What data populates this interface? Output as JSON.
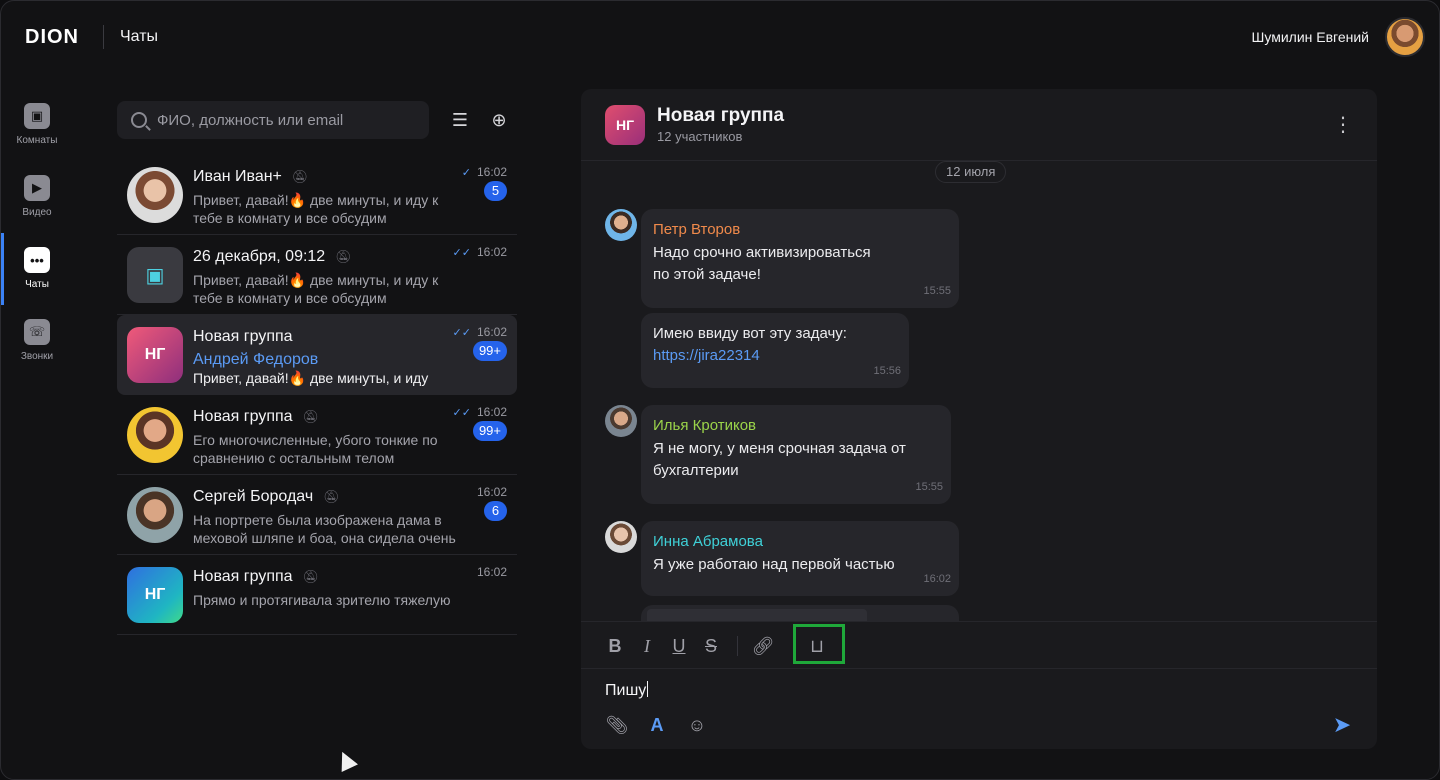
{
  "app": {
    "logo": "DION",
    "section_title": "Чаты",
    "user_name": "Шумилин Евгений"
  },
  "rail": [
    {
      "label": "Комнаты",
      "icon": "rooms-icon",
      "glyph": "▣"
    },
    {
      "label": "Видео",
      "icon": "video-icon",
      "glyph": "▶"
    },
    {
      "label": "Чаты",
      "icon": "chat-icon",
      "glyph": "•••",
      "active": true
    },
    {
      "label": "Звонки",
      "icon": "calls-icon",
      "glyph": "☏"
    }
  ],
  "search": {
    "placeholder": "ФИО, должность или email"
  },
  "chats": [
    {
      "name": "Иван Иван+",
      "preview": "Привет, давай!🔥 две минуты, и иду к тебе в комнату и все обсудим",
      "time": "16:02",
      "check": "✓",
      "badge": "5",
      "muted": true
    },
    {
      "name": "26 декабря, 09:12",
      "preview": "Привет, давай!🔥 две минуты, и иду к тебе в комнату и все обсудим",
      "time": "16:02",
      "check": "✓✓",
      "badge": "",
      "muted": true
    },
    {
      "name": "Новая группа",
      "author": "Андрей Федоров",
      "preview": "Привет, давай!🔥 две минуты, и иду",
      "time": "16:02",
      "check": "✓✓",
      "badge": "99+",
      "initials": "НГ",
      "muted": false
    },
    {
      "name": "Новая группа",
      "preview": "Его многочисленные, убого тонкие по сравнению с остальным телом",
      "time": "16:02",
      "check": "✓✓",
      "badge": "99+",
      "muted": true
    },
    {
      "name": "Сергей Бородач",
      "preview": "На портрете была изображена дама в меховой шляпе и боа, она сидела очень",
      "time": "16:02",
      "check": "",
      "badge": "6",
      "muted": true
    },
    {
      "name": "Новая группа",
      "preview": "Прямо и протягивала зрителю тяжелую",
      "time": "16:02",
      "check": "",
      "badge": "",
      "initials": "НГ",
      "muted": true
    }
  ],
  "panel": {
    "initials": "НГ",
    "title": "Новая группа",
    "members": "12 участников",
    "date": "12 июля",
    "messages": [
      {
        "sender": "Петр Второв",
        "sender_color": "#f08a4b",
        "text_1": "Надо срочно активизироваться",
        "text_2": "по этой задаче!",
        "time": "15:55"
      },
      {
        "text_1": "Имею ввиду вот эту задачу:",
        "link": "https://jira22314",
        "time": "15:56"
      },
      {
        "sender": "Илья Кротиков",
        "sender_color": "#9bd44a",
        "text_1": "Я не могу, у меня срочная задача от",
        "text_2": "бухгалтерии",
        "time": "15:55"
      },
      {
        "sender": "Инна Абрамова",
        "sender_color": "#3fd1d8",
        "text_1": "Я уже работаю над первой частью",
        "time": "16:02"
      }
    ],
    "composer": {
      "draft": "Пишу"
    }
  }
}
